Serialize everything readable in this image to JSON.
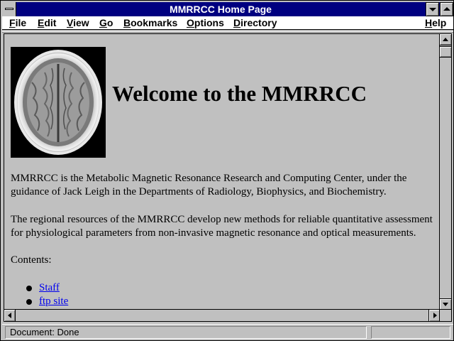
{
  "window": {
    "title": "MMRRCC Home Page"
  },
  "menu": {
    "items": [
      {
        "label": "File",
        "u": "F",
        "rest": "ile"
      },
      {
        "label": "Edit",
        "u": "E",
        "rest": "dit"
      },
      {
        "label": "View",
        "u": "V",
        "rest": "iew"
      },
      {
        "label": "Go",
        "u": "G",
        "rest": "o"
      },
      {
        "label": "Bookmarks",
        "u": "B",
        "rest": "ookmarks"
      },
      {
        "label": "Options",
        "u": "O",
        "rest": "ptions"
      },
      {
        "label": "Directory",
        "u": "D",
        "rest": "irectory"
      },
      {
        "label": "Help",
        "u": "H",
        "rest": "elp"
      }
    ]
  },
  "page": {
    "heading": "Welcome to the MMRRCC",
    "para1": "MMRRCC is the Metabolic Magnetic Resonance Research and Computing Center, under the guidance of Jack Leigh in the Departments of Radiology, Biophysics, and Biochemistry.",
    "para2": "The regional resources of the MMRRCC develop new methods for reliable quantitative assessment for physiological parameters from non-invasive magnetic resonance and optical measurements.",
    "contents_label": "Contents:",
    "links": [
      "Staff",
      "ftp site"
    ]
  },
  "status": {
    "text": "Document: Done"
  },
  "colors": {
    "titlebar": "#000080",
    "link": "#0000ee",
    "chrome": "#c0c0c0"
  }
}
